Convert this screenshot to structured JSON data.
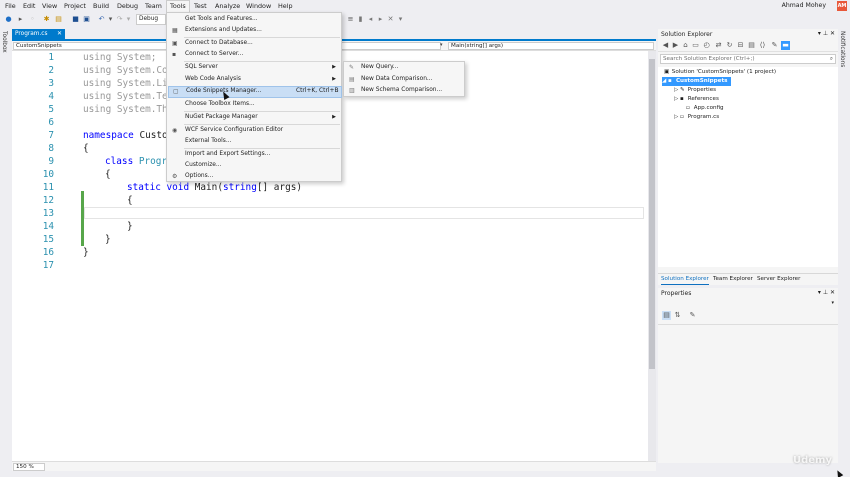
{
  "menubar": {
    "items": [
      "File",
      "Edit",
      "View",
      "Project",
      "Build",
      "Debug",
      "Team",
      "Tools",
      "Test",
      "Analyze",
      "Window",
      "Help"
    ],
    "user_name": "Ahmad Mohey",
    "avatar_initials": "AM"
  },
  "toolbar": {
    "configuration": "Debug"
  },
  "side_strips": {
    "left": "Toolbox",
    "right": "Notifications"
  },
  "editor": {
    "tab_label": "Program.cs",
    "nav_project": "CustomSnippets",
    "nav_member": "Main(string[] args)",
    "zoom": "150 %",
    "line_numbers": [
      "1",
      "2",
      "3",
      "4",
      "5",
      "6",
      "7",
      "8",
      "9",
      "10",
      "11",
      "12",
      "13",
      "14",
      "15",
      "16",
      "17"
    ],
    "lines": {
      "l1": "using System;",
      "l2": "using System.Co",
      "l3": "using System.Li",
      "l4": "using System.Te",
      "l5": "using System.Th",
      "l7_kw": "namespace",
      "l7_name": " Custo",
      "l8": "{",
      "l9_kw": "class",
      "l9_name": " Progr",
      "l10": "{",
      "l11_kw1": "static",
      "l11_kw2": " void",
      "l11_rest1": " Main(",
      "l11_kw3": "string",
      "l11_rest2": "[] args)",
      "l12": "{",
      "l14": "}",
      "l15": "}",
      "l16": "}"
    }
  },
  "tools_menu": {
    "items": [
      {
        "label": "Get Tools and Features..."
      },
      {
        "label": "Extensions and Updates..."
      },
      {
        "label": "Connect to Database..."
      },
      {
        "label": "Connect to Server..."
      },
      {
        "label": "SQL Server"
      },
      {
        "label": "Web Code Analysis"
      },
      {
        "label": "Code Snippets Manager...",
        "shortcut": "Ctrl+K, Ctrl+B"
      },
      {
        "label": "Choose Toolbox Items..."
      },
      {
        "label": "NuGet Package Manager"
      },
      {
        "label": "WCF Service Configuration Editor"
      },
      {
        "label": "External Tools..."
      },
      {
        "label": "Import and Export Settings..."
      },
      {
        "label": "Customize..."
      },
      {
        "label": "Options..."
      }
    ]
  },
  "sql_submenu": {
    "items": [
      "New Query...",
      "New Data Comparison...",
      "New Schema Comparison..."
    ]
  },
  "solution_explorer": {
    "title": "Solution Explorer",
    "search_placeholder": "Search Solution Explorer (Ctrl+;)",
    "solution": "Solution 'CustomSnippets' (1 project)",
    "project": "CustomSnippets",
    "items": [
      "Properties",
      "References",
      "App.config",
      "Program.cs"
    ],
    "tabs": [
      "Solution Explorer",
      "Team Explorer",
      "Server Explorer"
    ]
  },
  "properties": {
    "title": "Properties"
  },
  "watermark": "Udemy",
  "colors": {
    "accent": "#007acc",
    "selection": "#3399ff",
    "keyword": "#0000ff",
    "type": "#2b91af",
    "change_bar": "#57a64a"
  }
}
